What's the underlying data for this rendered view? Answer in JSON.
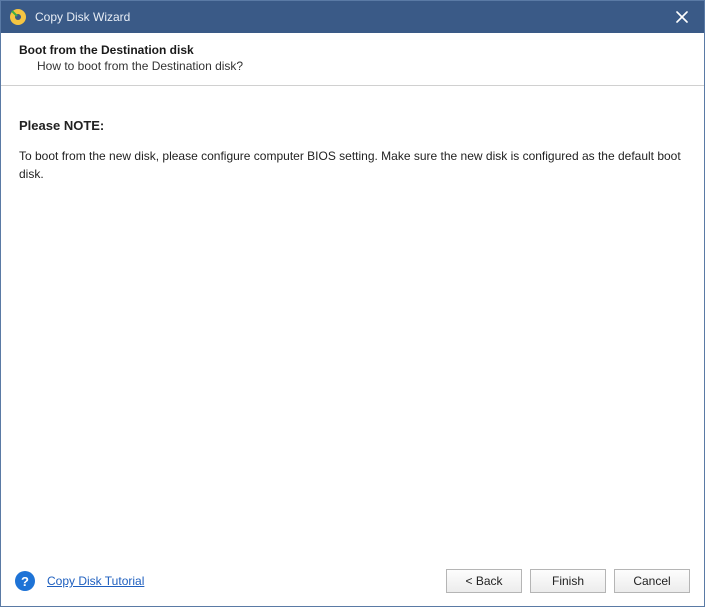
{
  "titlebar": {
    "title": "Copy Disk Wizard"
  },
  "header": {
    "title": "Boot from the Destination disk",
    "subtitle": "How to boot from the Destination disk?"
  },
  "content": {
    "note_label": "Please NOTE:",
    "note_body": "To boot from the new disk, please configure computer BIOS setting. Make sure the new disk is configured as the default boot disk."
  },
  "footer": {
    "tutorial_link": "Copy Disk Tutorial",
    "back_label": "< Back",
    "finish_label": "Finish",
    "cancel_label": "Cancel"
  }
}
